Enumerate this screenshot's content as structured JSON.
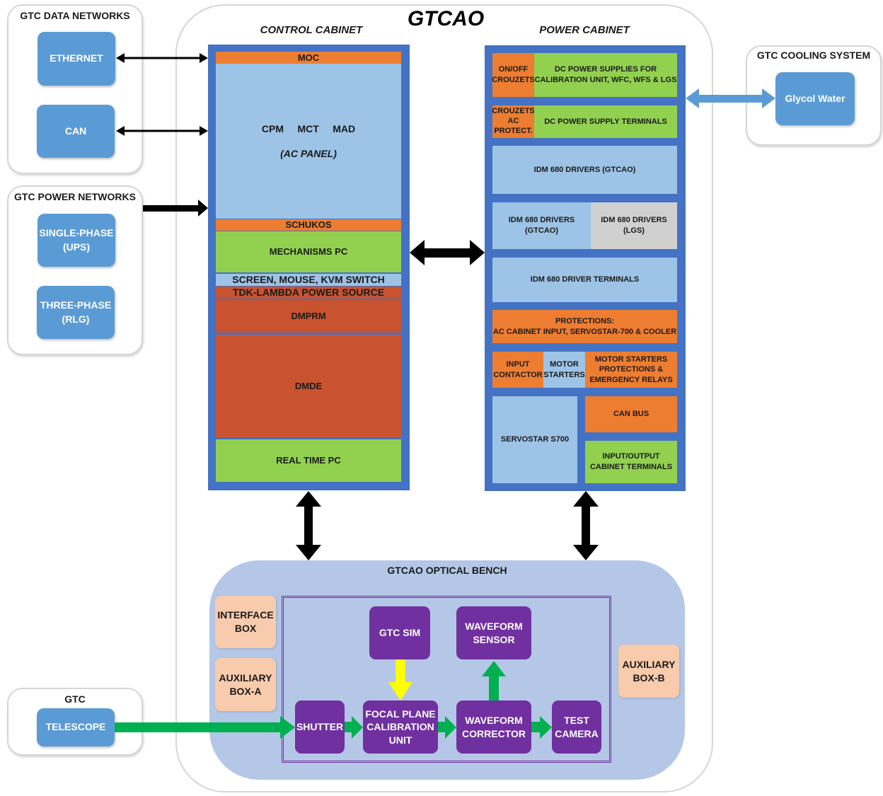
{
  "title": "GTCAO",
  "data_networks": {
    "title": "GTC DATA NETWORKS",
    "items": [
      "ETHERNET",
      "CAN"
    ]
  },
  "power_networks": {
    "title": "GTC POWER NETWORKS",
    "items": [
      [
        "SINGLE-PHASE",
        "(UPS)"
      ],
      [
        "THREE-PHASE",
        "(RLG)"
      ]
    ]
  },
  "gtc": {
    "title": "GTC",
    "item": "TELESCOPE"
  },
  "cooling": {
    "title": "GTC COOLING SYSTEM",
    "item": "Glycol Water"
  },
  "control_cabinet": {
    "title": "CONTROL CABINET",
    "moc": "MOC",
    "ac_panel_items": "CPM     MCT     MAD",
    "ac_panel_label": "(AC PANEL)",
    "schukos": "SCHUKOS",
    "mechanisms_pc": "MECHANISMS PC",
    "screen": "SCREEN, MOUSE, KVM SWITCH",
    "tdk": "TDK-LAMBDA POWER SOURCE",
    "dmprm": "DMPRM",
    "dmde": "DMDE",
    "real_time_pc": "REAL TIME PC"
  },
  "power_cabinet": {
    "title": "POWER CABINET",
    "on_off": [
      "ON/OFF",
      "CROUZETS"
    ],
    "dc_supplies": [
      "DC POWER SUPPLIES FOR",
      "CALIBRATION UNIT, WFC, WFS & LGS"
    ],
    "crouzets_ac": [
      "CROUZETS",
      "AC",
      "PROTECT."
    ],
    "dc_terminals": "DC POWER SUPPLY TERMINALS",
    "idm_gtcao": "IDM 680 DRIVERS (GTCAO)",
    "idm_gtcao_2": [
      "IDM 680 DRIVERS",
      "(GTCAO)"
    ],
    "idm_lgs": [
      "IDM 680 DRIVERS",
      "(LGS)"
    ],
    "idm_terminals": "IDM 680 DRIVER TERMINALS",
    "protections": [
      "PROTECTIONS:",
      "AC CABINET INPUT, SERVOSTAR-700 & COOLER"
    ],
    "input_contactor": [
      "INPUT",
      "CONTACTOR"
    ],
    "motor_starters": [
      "MOTOR",
      "STARTERS"
    ],
    "motor_protections": [
      "MOTOR STARTERS",
      "PROTECTIONS &",
      "EMERGENCY RELAYS"
    ],
    "servostar": "SERVOSTAR S700",
    "can_bus": "CAN BUS",
    "io_terminals": [
      "INPUT/OUTPUT",
      "CABINET TERMINALS"
    ]
  },
  "optical_bench": {
    "title": "GTCAO OPTICAL BENCH",
    "interface_box": [
      "INTERFACE",
      "BOX"
    ],
    "aux_a": [
      "AUXILIARY",
      "BOX-A"
    ],
    "aux_b": [
      "AUXILIARY",
      "BOX-B"
    ],
    "gtc_sim": "GTC SIM",
    "wf_sensor": [
      "WAVEFORM",
      "SENSOR"
    ],
    "shutter": "SHUTTER",
    "focal_plane": [
      "FOCAL PLANE",
      "CALIBRATION",
      "UNIT"
    ],
    "wf_corrector": [
      "WAVEFORM",
      "CORRECTOR"
    ],
    "test_camera": [
      "TEST",
      "CAMERA"
    ]
  },
  "colors": {
    "cabinet_frame": "#4472c4",
    "orange": "#ed7d31",
    "light_blue": "#9dc3e6",
    "green": "#92d050",
    "rust": "#c9532f",
    "grey": "#d0d0d0",
    "node_blue": "#5b9bd5",
    "bench": "#b4c7e7",
    "purple": "#7030a0",
    "peach": "#f8cbad",
    "flow_green": "#00b050",
    "flow_yellow": "#ffff00"
  }
}
